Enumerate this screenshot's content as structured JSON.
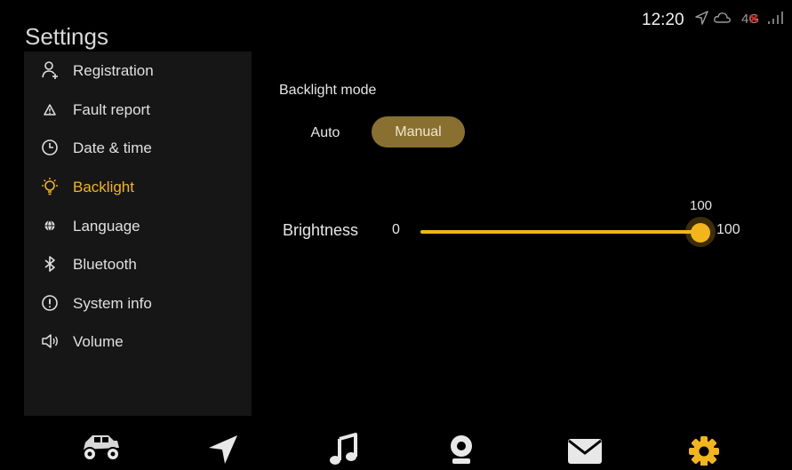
{
  "status_bar": {
    "time": "12:20",
    "icons": [
      "location-arrow-icon",
      "cloud-icon",
      "network-4g-icon",
      "signal-bars-icon"
    ],
    "network_label": "4G"
  },
  "header": {
    "title": "Settings"
  },
  "sidebar": {
    "items": [
      {
        "label": "Registration",
        "icon": "person-add-icon",
        "active": false
      },
      {
        "label": "Fault report",
        "icon": "warning-triangle-icon",
        "active": false
      },
      {
        "label": "Date & time",
        "icon": "clock-icon",
        "active": false
      },
      {
        "label": "Backlight",
        "icon": "lightbulb-icon",
        "active": true
      },
      {
        "label": "Language",
        "icon": "globe-icon",
        "active": false
      },
      {
        "label": "Bluetooth",
        "icon": "bluetooth-icon",
        "active": false
      },
      {
        "label": "System info",
        "icon": "info-icon",
        "active": false
      },
      {
        "label": "Volume",
        "icon": "speaker-icon",
        "active": false
      }
    ]
  },
  "backlight": {
    "mode_label": "Backlight mode",
    "modes": [
      {
        "label": "Auto",
        "selected": false
      },
      {
        "label": "Manual",
        "selected": true
      }
    ],
    "brightness": {
      "label": "Brightness",
      "min_label": "0",
      "max_label": "100",
      "value": 100,
      "min": 0,
      "max": 100,
      "value_label": "100"
    }
  },
  "dock": {
    "items": [
      {
        "icon": "vehicle-icon",
        "active": false
      },
      {
        "icon": "navigation-arrow-icon",
        "active": false
      },
      {
        "icon": "music-note-icon",
        "active": false
      },
      {
        "icon": "camera-icon",
        "active": false
      },
      {
        "icon": "mail-icon",
        "active": false
      },
      {
        "icon": "settings-gear-icon",
        "active": true
      }
    ]
  },
  "colors": {
    "accent": "#f2b51b",
    "selected_mode_bg": "#8a7030",
    "sidebar_bg": "#161616",
    "background": "#000000",
    "network_error": "#e02020"
  }
}
